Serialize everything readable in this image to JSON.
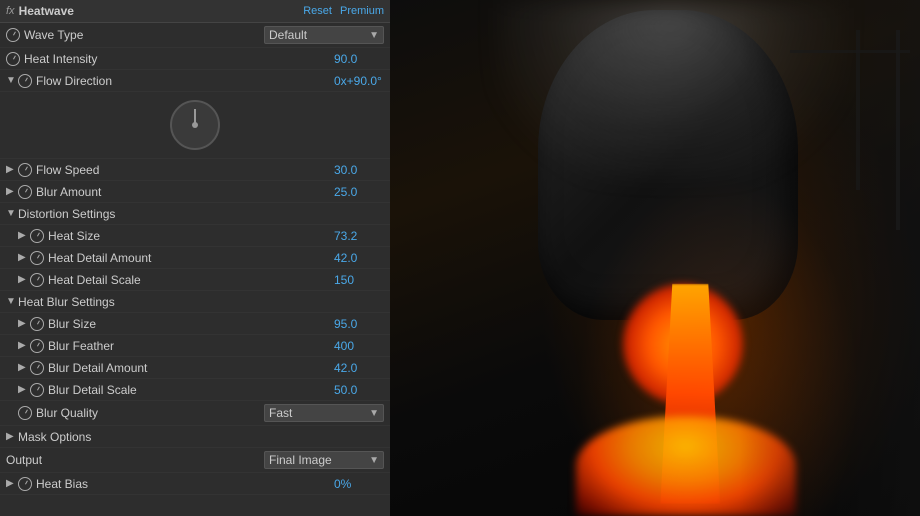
{
  "fx": {
    "label": "fx",
    "title": "Heatwave",
    "reset": "Reset",
    "premium": "Premium"
  },
  "params": {
    "wave_type": {
      "label": "Wave Type",
      "value": "Default",
      "type": "dropdown"
    },
    "heat_intensity": {
      "label": "Heat Intensity",
      "value": "90.0"
    },
    "flow_direction": {
      "label": "Flow Direction",
      "value": "0x+90.0°"
    },
    "flow_speed": {
      "label": "Flow Speed",
      "value": "30.0"
    },
    "blur_amount": {
      "label": "Blur Amount",
      "value": "25.0"
    },
    "distortion_settings": {
      "label": "Distortion Settings"
    },
    "heat_size": {
      "label": "Heat Size",
      "value": "73.2"
    },
    "heat_detail_amount": {
      "label": "Heat Detail Amount",
      "value": "42.0"
    },
    "heat_detail_scale": {
      "label": "Heat Detail Scale",
      "value": "150"
    },
    "heat_blur_settings": {
      "label": "Heat Blur Settings"
    },
    "blur_size": {
      "label": "Blur Size",
      "value": "95.0"
    },
    "blur_feather": {
      "label": "Blur Feather",
      "value": "400"
    },
    "blur_detail_amount": {
      "label": "Blur Detail Amount",
      "value": "42.0"
    },
    "blur_detail_scale": {
      "label": "Blur Detail Scale",
      "value": "50.0"
    },
    "blur_quality": {
      "label": "Blur Quality",
      "value": "Fast",
      "type": "dropdown"
    },
    "mask_options": {
      "label": "Mask Options"
    },
    "output": {
      "label": "Output",
      "value": "Final Image",
      "type": "dropdown"
    },
    "heat_bias": {
      "label": "Heat Bias",
      "value": "0%"
    }
  }
}
